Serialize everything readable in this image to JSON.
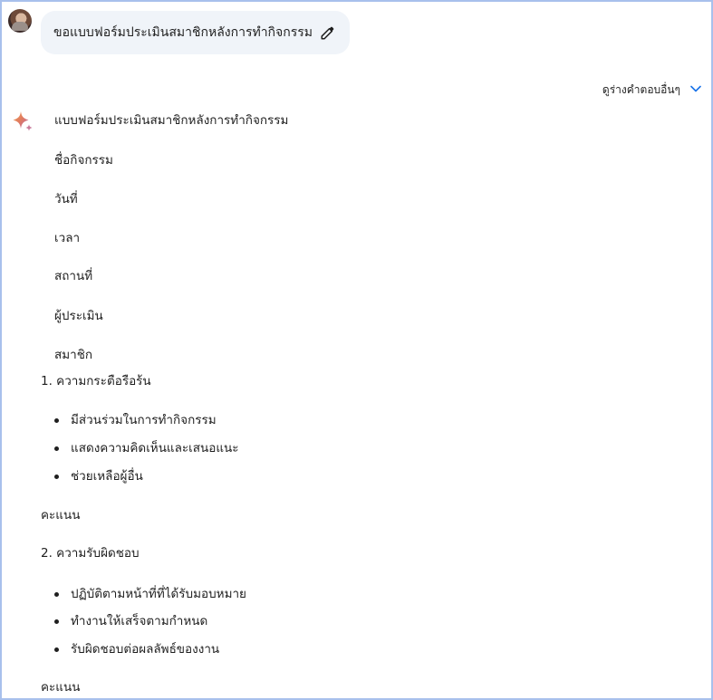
{
  "user": {
    "prompt": "ขอแบบฟอร์มประเมินสมาชิกหลังการทำกิจกรรม",
    "edit_icon": "pencil-icon"
  },
  "drafts": {
    "label": "ดูร่างคำตอบอื่นๆ",
    "icon": "chevron-down-icon"
  },
  "response": {
    "title": "แบบฟอร์มประเมินสมาชิกหลังการทำกิจกรรม",
    "fields": [
      "ชื่อกิจกรรม",
      "วันที่",
      "เวลา",
      "สถานที่",
      "ผู้ประเมิน",
      "สมาชิก"
    ],
    "sections": [
      {
        "heading": "1. ความกระตือรือร้น",
        "items": [
          "มีส่วนร่วมในการทำกิจกรรม",
          "แสดงความคิดเห็นและเสนอแนะ",
          "ช่วยเหลือผู้อื่น"
        ],
        "score_label": "คะแนน"
      },
      {
        "heading": "2. ความรับผิดชอบ",
        "items": [
          "ปฏิบัติตามหน้าที่ที่ได้รับมอบหมาย",
          "ทำงานให้เสร็จตามกำหนด",
          "รับผิดชอบต่อผลลัพธ์ของงาน"
        ],
        "score_label": "คะแนน"
      }
    ]
  },
  "colors": {
    "frame_border": "#a8c0ec",
    "bubble_bg": "#f0f4f9",
    "text": "#1f1f1f",
    "chevron": "#1a73e8"
  }
}
